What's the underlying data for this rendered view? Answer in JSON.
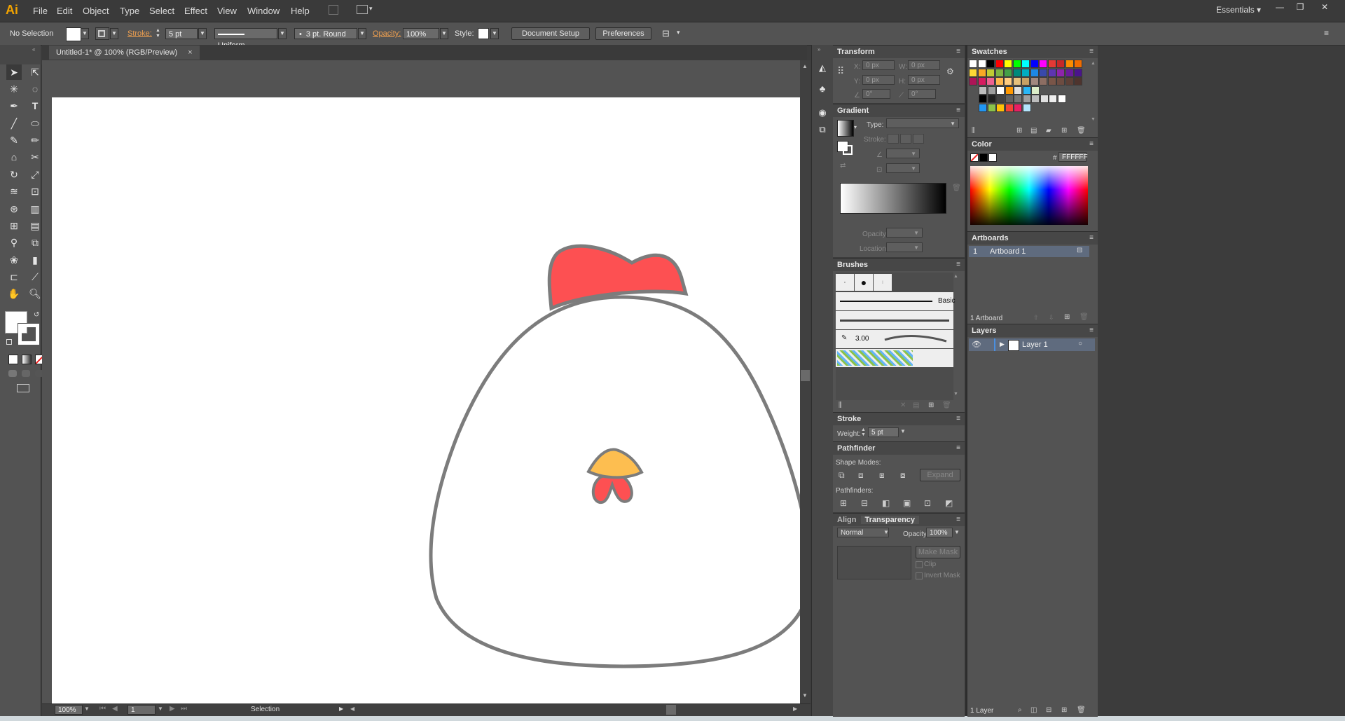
{
  "app": {
    "logo": "Ai",
    "workspace": "Essentials ▾"
  },
  "menu": [
    "File",
    "Edit",
    "Object",
    "Type",
    "Select",
    "Effect",
    "View",
    "Window",
    "Help"
  ],
  "control": {
    "selection": "No Selection",
    "stroke_label": "Stroke:",
    "stroke_value": "5 pt",
    "profile": "Uniform",
    "brush": "3 pt. Round",
    "opacity_label": "Opacity:",
    "opacity_value": "100%",
    "style_label": "Style:",
    "doc_setup": "Document Setup",
    "preferences": "Preferences"
  },
  "document": {
    "tab": "Untitled-1* @ 100% (RGB/Preview)",
    "close": "×"
  },
  "status": {
    "zoom": "100%",
    "page": "1",
    "tool": "Selection"
  },
  "transform": {
    "title": "Transform",
    "x_label": "X:",
    "y_label": "Y:",
    "w_label": "W:",
    "h_label": "H:",
    "x": "0 px",
    "y": "0 px",
    "w": "0 px",
    "h": "0 px",
    "rot": "0°",
    "shear": "0°"
  },
  "gradient": {
    "title": "Gradient",
    "type_label": "Type:",
    "stroke_label": "Stroke:",
    "opacity_label": "Opacity:",
    "location_label": "Location:"
  },
  "brushes": {
    "title": "Brushes",
    "basic": "Basic",
    "size": "3.00"
  },
  "stroke_panel": {
    "title": "Stroke",
    "weight_label": "Weight:",
    "weight": "5 pt"
  },
  "pathfinder": {
    "title": "Pathfinder",
    "shape_modes": "Shape Modes:",
    "pathfinders": "Pathfinders:",
    "expand": "Expand"
  },
  "transparency": {
    "align_tab": "Align",
    "title": "Transparency",
    "mode": "Normal",
    "opacity_label": "Opacity:",
    "opacity": "100%",
    "make_mask": "Make Mask",
    "clip": "Clip",
    "invert": "Invert Mask"
  },
  "swatches": {
    "title": "Swatches"
  },
  "color": {
    "title": "Color",
    "hash": "#",
    "hex": "FFFFFF"
  },
  "artboards": {
    "title": "Artboards",
    "row_num": "1",
    "row_name": "Artboard 1",
    "count": "1 Artboard"
  },
  "layers": {
    "title": "Layers",
    "layer_name": "Layer 1",
    "count": "1 Layer"
  },
  "colors": {
    "accent": "#f2a300",
    "comb": "#fd5052",
    "beak": "#fdbe50",
    "outline": "#7c7c7c"
  }
}
